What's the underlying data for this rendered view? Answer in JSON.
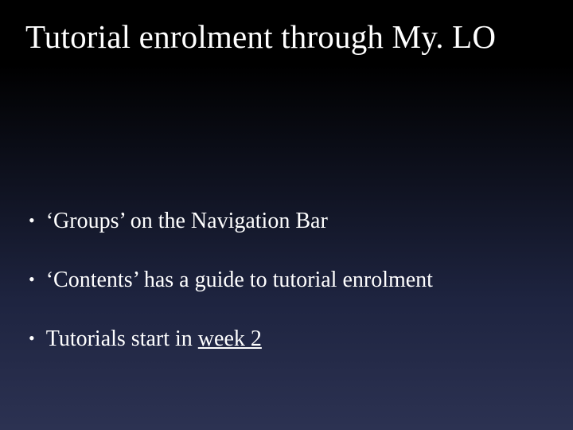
{
  "slide": {
    "title": "Tutorial enrolment through My. LO",
    "bullets": [
      {
        "prefix": "‘Groups’ on the Navigation Bar",
        "suffix": ""
      },
      {
        "prefix": "‘Contents’ has a guide to tutorial enrolment",
        "suffix": ""
      },
      {
        "prefix": "Tutorials start in ",
        "suffix": "week 2"
      }
    ]
  }
}
